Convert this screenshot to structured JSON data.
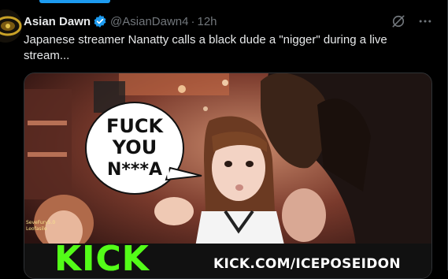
{
  "tweet": {
    "display_name": "Asian Dawn",
    "handle": "@AsianDawn4",
    "separator": "·",
    "time": "12h",
    "text": "Japanese streamer Nanatty calls a black dude a \"nigger\" during a live stream..."
  },
  "media": {
    "speech_bubble_lines": [
      "FUCK",
      "YOU",
      "N***A"
    ],
    "kick_logo": "KICK",
    "kick_url": "KICK.COM/ICEPOSEIDON",
    "chat_overlay_lines": [
      "SeveFury5.0",
      "Leofasilo"
    ]
  },
  "icons": {
    "verified": "verified-badge-icon",
    "grok": "grok-icon",
    "more": "more-options-icon"
  },
  "colors": {
    "background": "#000000",
    "primary_text": "#e7e9ea",
    "secondary_text": "#71767b",
    "accent": "#1d9bf0",
    "kick_green": "#53fc18"
  }
}
